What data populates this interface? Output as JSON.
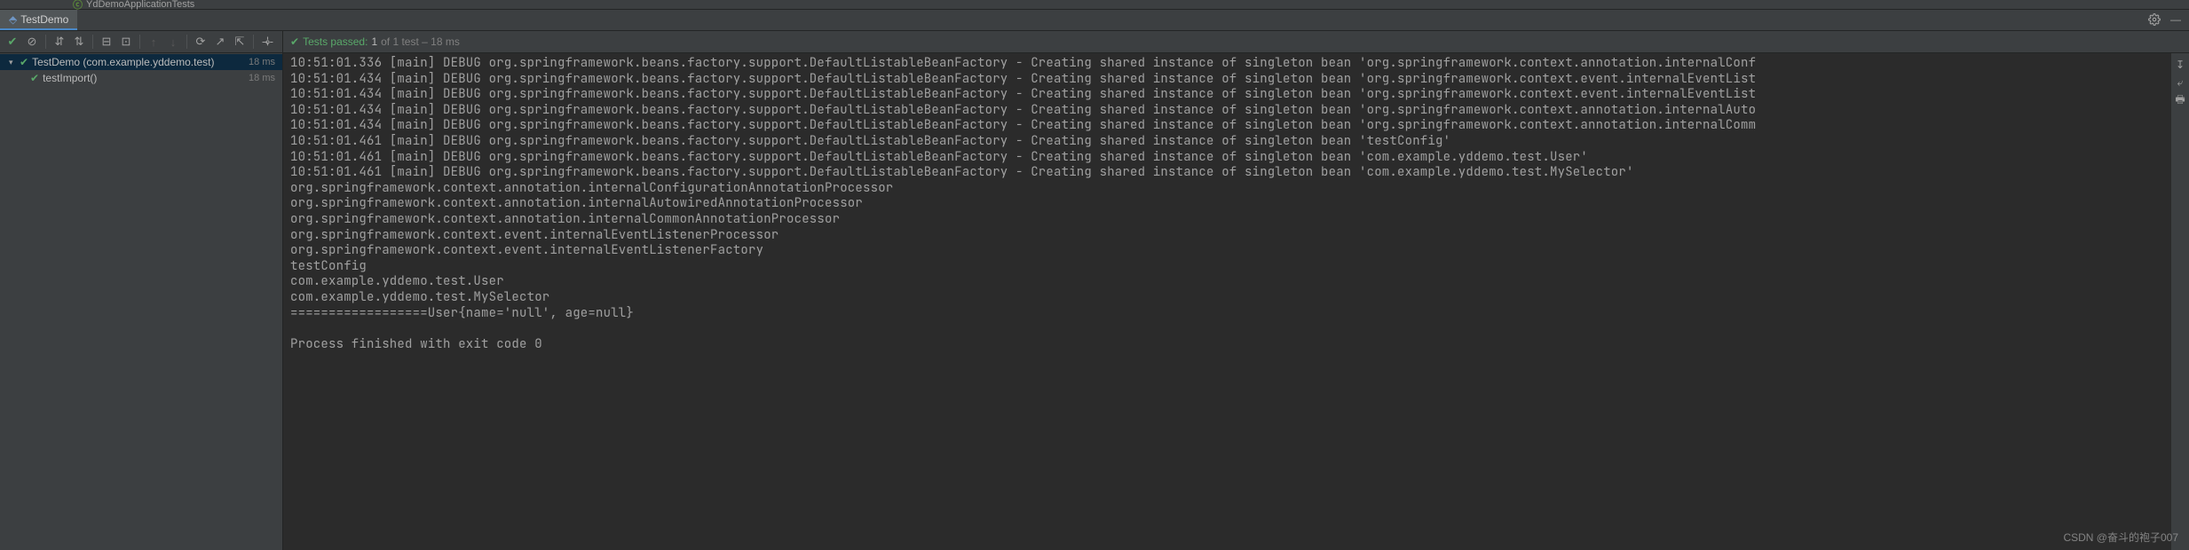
{
  "top": {
    "fileTab": "YdDemoApplicationTests"
  },
  "tab": {
    "label": "TestDemo"
  },
  "status": {
    "prefix": "Tests passed:",
    "passed": "1",
    "rest": "of 1 test – 18 ms"
  },
  "tree": {
    "root": {
      "label": "TestDemo (com.example.yddemo.test)",
      "time": "18 ms"
    },
    "child": {
      "label": "testImport()",
      "time": "18 ms"
    }
  },
  "console_lines": [
    "10:51:01.336 [main] DEBUG org.springframework.beans.factory.support.DefaultListableBeanFactory - Creating shared instance of singleton bean 'org.springframework.context.annotation.internalConf",
    "10:51:01.434 [main] DEBUG org.springframework.beans.factory.support.DefaultListableBeanFactory - Creating shared instance of singleton bean 'org.springframework.context.event.internalEventList",
    "10:51:01.434 [main] DEBUG org.springframework.beans.factory.support.DefaultListableBeanFactory - Creating shared instance of singleton bean 'org.springframework.context.event.internalEventList",
    "10:51:01.434 [main] DEBUG org.springframework.beans.factory.support.DefaultListableBeanFactory - Creating shared instance of singleton bean 'org.springframework.context.annotation.internalAuto",
    "10:51:01.434 [main] DEBUG org.springframework.beans.factory.support.DefaultListableBeanFactory - Creating shared instance of singleton bean 'org.springframework.context.annotation.internalComm",
    "10:51:01.461 [main] DEBUG org.springframework.beans.factory.support.DefaultListableBeanFactory - Creating shared instance of singleton bean 'testConfig'",
    "10:51:01.461 [main] DEBUG org.springframework.beans.factory.support.DefaultListableBeanFactory - Creating shared instance of singleton bean 'com.example.yddemo.test.User'",
    "10:51:01.461 [main] DEBUG org.springframework.beans.factory.support.DefaultListableBeanFactory - Creating shared instance of singleton bean 'com.example.yddemo.test.MySelector'",
    "org.springframework.context.annotation.internalConfigurationAnnotationProcessor",
    "org.springframework.context.annotation.internalAutowiredAnnotationProcessor",
    "org.springframework.context.annotation.internalCommonAnnotationProcessor",
    "org.springframework.context.event.internalEventListenerProcessor",
    "org.springframework.context.event.internalEventListenerFactory",
    "testConfig",
    "com.example.yddemo.test.User",
    "com.example.yddemo.test.MySelector",
    "==================User{name='null', age=null}",
    "",
    "Process finished with exit code 0"
  ],
  "watermark": "CSDN @奋斗的袍子007"
}
